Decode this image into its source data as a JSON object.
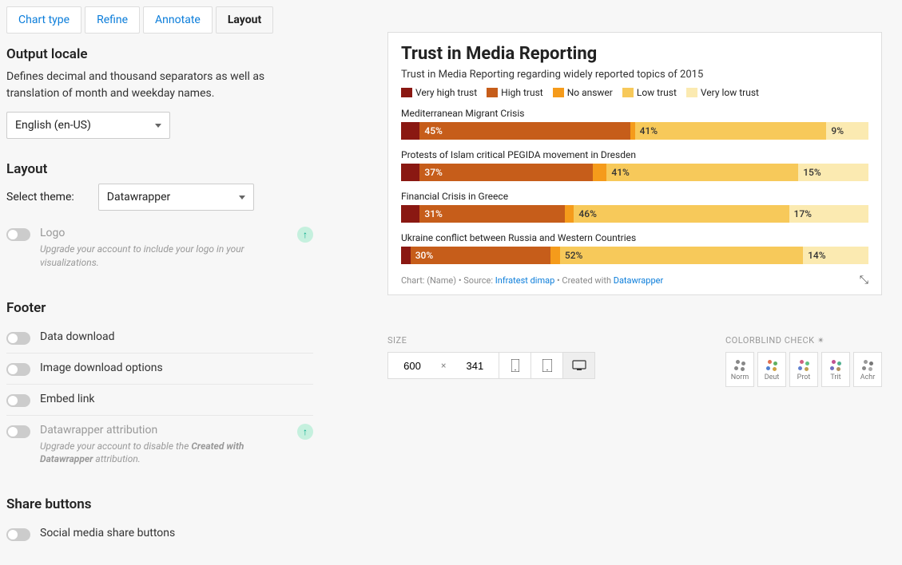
{
  "tabs": [
    "Chart type",
    "Refine",
    "Annotate",
    "Layout"
  ],
  "active_tab": 3,
  "locale": {
    "heading": "Output locale",
    "desc": "Defines decimal and thousand separators as well as translation of month and weekday names.",
    "value": "English (en-US)"
  },
  "layout": {
    "heading": "Layout",
    "theme_label": "Select theme:",
    "theme_value": "Datawrapper",
    "logo_label": "Logo",
    "logo_help": "Upgrade your account to include your logo in your visualizations."
  },
  "footer": {
    "heading": "Footer",
    "data_download": "Data download",
    "image_download": "Image download options",
    "embed_link": "Embed link",
    "attribution": "Datawrapper attribution",
    "attribution_help_pre": "Upgrade your account to disable the ",
    "attribution_help_bold": "Created with Datawrapper",
    "attribution_help_post": " attribution."
  },
  "share": {
    "heading": "Share buttons",
    "social": "Social media share buttons"
  },
  "size": {
    "label": "SIZE",
    "w": "600",
    "h": "341"
  },
  "colorblind": {
    "label": "COLORBLIND CHECK",
    "modes": [
      "Norm",
      "Deut",
      "Prot",
      "Trit",
      "Achr"
    ]
  },
  "chart_data": {
    "type": "bar",
    "title": "Trust in Media Reporting",
    "subtitle": "Trust in Media Reporting regarding widely reported topics of 2015",
    "legend": [
      "Very high trust",
      "High trust",
      "No answer",
      "Low trust",
      "Very low trust"
    ],
    "colors": [
      "#8a1812",
      "#c65d1a",
      "#f59b1b",
      "#f7c95a",
      "#fbeab1"
    ],
    "categories": [
      "Mediterranean Migrant Crisis",
      "Protests of Islam critical PEGIDA movement in Dresden",
      "Financial Crisis in Greece",
      "Ukraine conflict between Russia and Western Countries"
    ],
    "series_values": [
      [
        4,
        45,
        1,
        41,
        9
      ],
      [
        4,
        37,
        3,
        41,
        15
      ],
      [
        4,
        31,
        2,
        46,
        17
      ],
      [
        2,
        30,
        2,
        52,
        14
      ]
    ],
    "visible_labels": [
      {
        "1": "45%",
        "3": "41%",
        "4": "9%"
      },
      {
        "1": "37%",
        "3": "41%",
        "4": "15%"
      },
      {
        "1": "31%",
        "3": "46%",
        "4": "17%"
      },
      {
        "1": "30%",
        "3": "52%",
        "4": "14%"
      }
    ],
    "footer_pre": "Chart: (Name) • Source: ",
    "footer_source": "Infratest dimap",
    "footer_mid": " • Created with ",
    "footer_tool": "Datawrapper"
  }
}
